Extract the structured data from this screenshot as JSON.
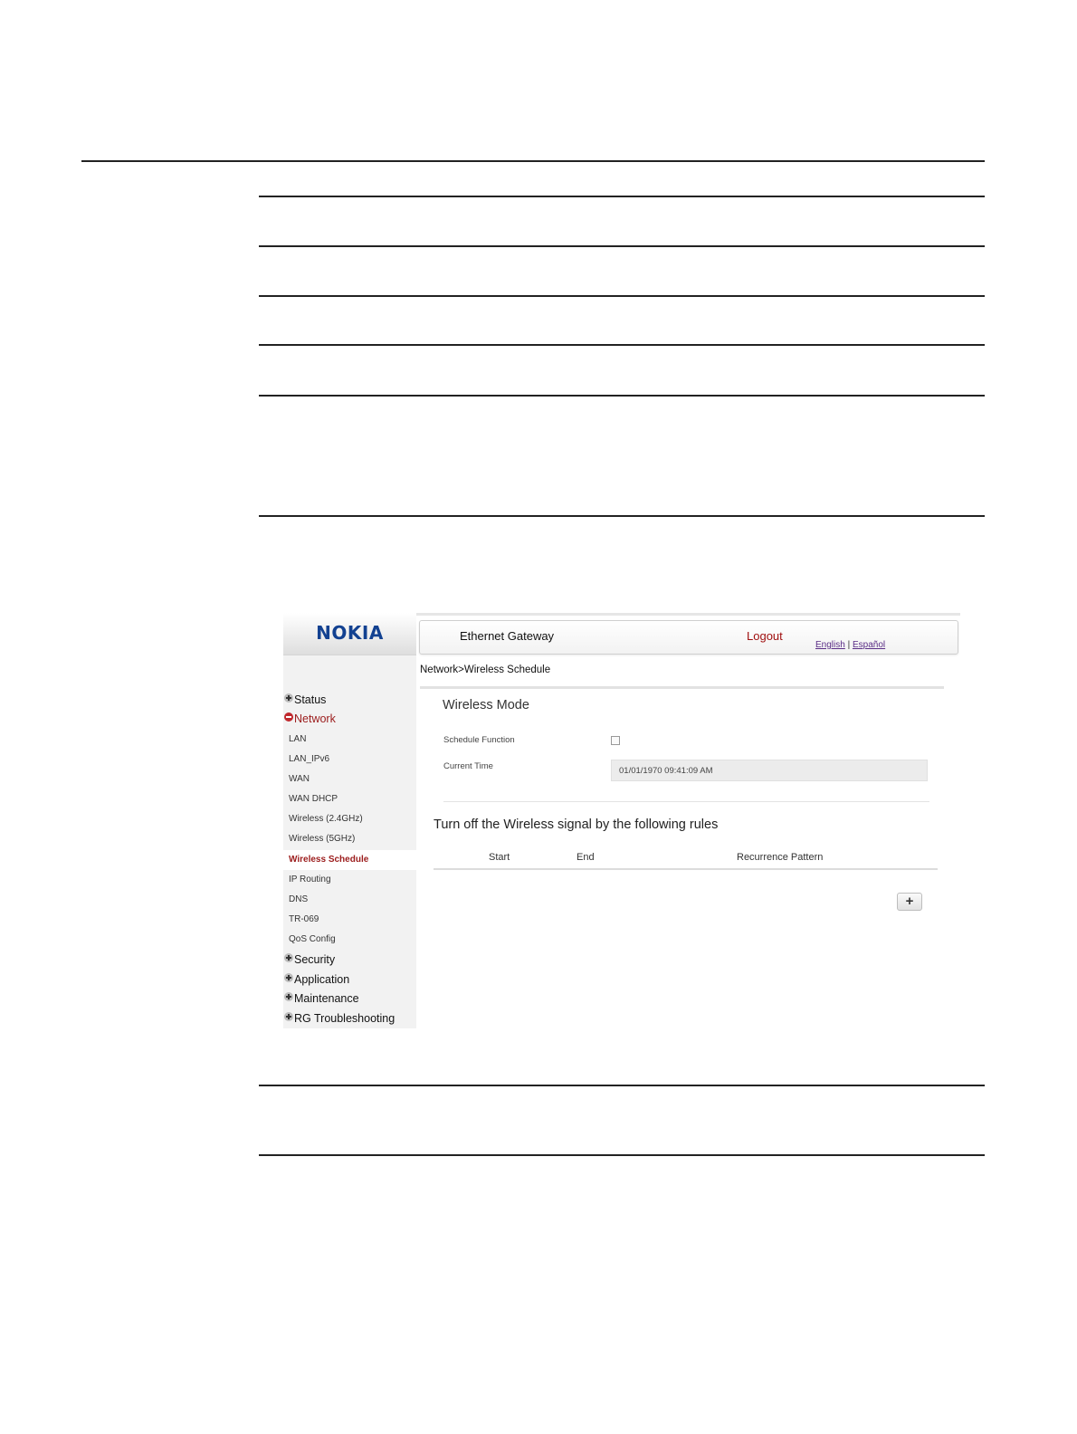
{
  "sidebar": {
    "logo": "NOKIA",
    "items": [
      {
        "label": "Status"
      },
      {
        "label": "Network"
      },
      {
        "label": "LAN"
      },
      {
        "label": "LAN_IPv6"
      },
      {
        "label": "WAN"
      },
      {
        "label": "WAN DHCP"
      },
      {
        "label": "Wireless (2.4GHz)"
      },
      {
        "label": "Wireless (5GHz)"
      },
      {
        "label": "Wireless Schedule"
      },
      {
        "label": "IP Routing"
      },
      {
        "label": "DNS"
      },
      {
        "label": "TR-069"
      },
      {
        "label": "QoS Config"
      },
      {
        "label": "Security"
      },
      {
        "label": "Application"
      },
      {
        "label": "Maintenance"
      },
      {
        "label": "RG Troubleshooting"
      }
    ]
  },
  "header": {
    "title": "Ethernet Gateway",
    "logout": "Logout",
    "lang_english": "English",
    "lang_separator": "|",
    "lang_spanish": "Español"
  },
  "breadcrumb": "Network>Wireless Schedule",
  "wireless_mode": {
    "title": "Wireless Mode",
    "schedule_function_label": "Schedule Function",
    "schedule_function_checked": false,
    "current_time_label": "Current Time",
    "current_time_value": "01/01/1970 09:41:09 AM"
  },
  "rules": {
    "title": "Turn off the Wireless signal by the following rules",
    "columns": [
      "Start",
      "End",
      "Recurrence Pattern"
    ],
    "add_button": "+"
  },
  "colors": {
    "brand": "#124191",
    "active": "#9b1b1b"
  }
}
